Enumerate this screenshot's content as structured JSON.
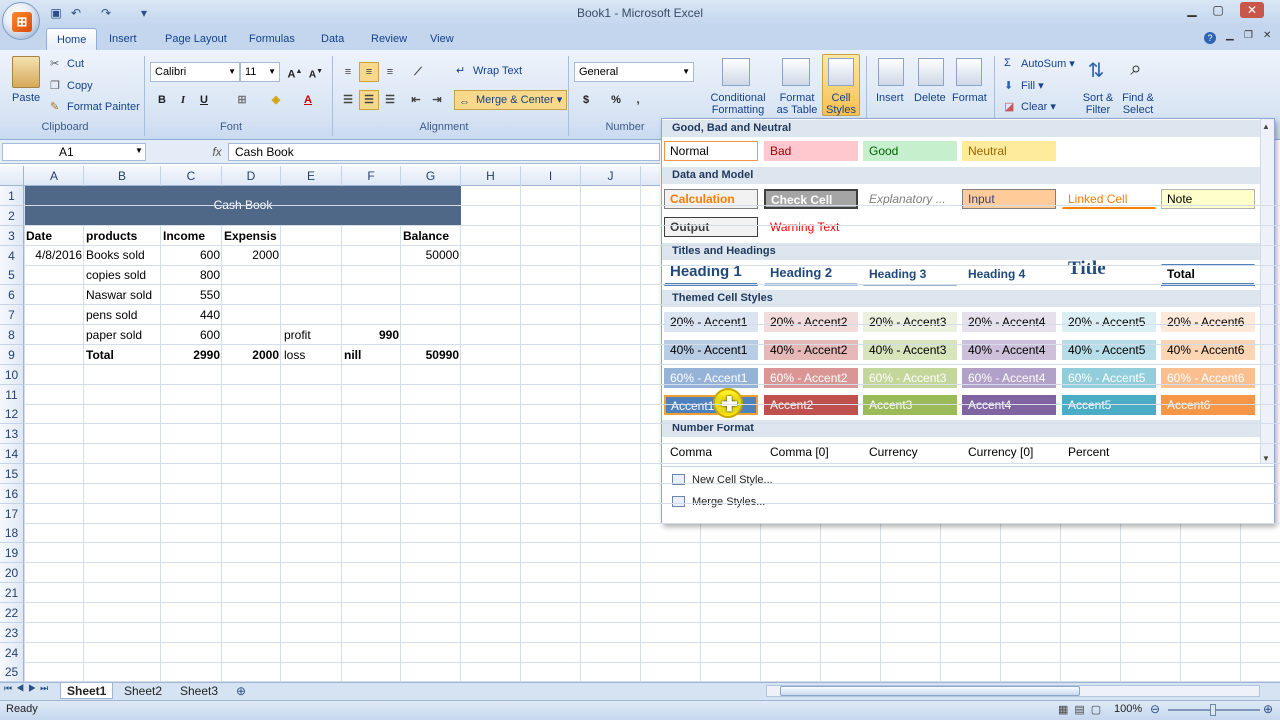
{
  "window": {
    "title": "Book1 - Microsoft Excel"
  },
  "tabs": [
    "Home",
    "Insert",
    "Page Layout",
    "Formulas",
    "Data",
    "Review",
    "View"
  ],
  "ribbon": {
    "clipboard": {
      "paste": "Paste",
      "cut": "Cut",
      "copy": "Copy",
      "format_painter": "Format Painter",
      "label": "Clipboard"
    },
    "font": {
      "name": "Calibri",
      "size": "11",
      "label": "Font",
      "bold": "B",
      "italic": "I",
      "underline": "U"
    },
    "alignment": {
      "wrap": "Wrap Text",
      "merge": "Merge & Center",
      "label": "Alignment"
    },
    "number": {
      "format": "General",
      "label": "Number",
      "currency": "$",
      "percent": "%",
      "comma": ","
    },
    "styles": {
      "conditional": "Conditional",
      "conditional2": "Formatting",
      "format_table": "Format",
      "format_table2": "as Table",
      "cell_styles": "Cell",
      "cell_styles2": "Styles"
    },
    "cells": {
      "insert": "Insert",
      "delete": "Delete",
      "format": "Format"
    },
    "editing": {
      "autosum": "AutoSum",
      "fill": "Fill",
      "clear": "Clear",
      "sort": "Sort &",
      "sort2": "Filter",
      "find": "Find &",
      "find2": "Select"
    }
  },
  "formula_bar": {
    "name_box": "A1",
    "fx": "fx",
    "value": "Cash Book"
  },
  "columns": [
    "A",
    "B",
    "C",
    "D",
    "E",
    "F",
    "G",
    "H",
    "I",
    "J"
  ],
  "rows": [
    "1",
    "2",
    "3",
    "4",
    "5",
    "6",
    "7",
    "8",
    "9",
    "10",
    "11",
    "12",
    "13",
    "14",
    "15",
    "16",
    "17",
    "18",
    "19",
    "20",
    "21",
    "22",
    "23",
    "24",
    "25"
  ],
  "sheet": {
    "merged_title": "Cash Book",
    "r3": {
      "a": "Date",
      "b": "products",
      "c": "Income",
      "d": "Expensis",
      "g": "Balance"
    },
    "r4": {
      "a": "4/8/2016",
      "b": "Books sold",
      "c": "600",
      "d": "2000",
      "g": "50000"
    },
    "r5": {
      "b": "copies sold",
      "c": "800"
    },
    "r6": {
      "b": "Naswar sold",
      "c": "550"
    },
    "r7": {
      "b": "pens sold",
      "c": "440"
    },
    "r8": {
      "b": "paper sold",
      "c": "600",
      "e": "profit",
      "f": "990"
    },
    "r9": {
      "b": "Total",
      "c": "2990",
      "d": "2000",
      "e": "loss",
      "f": "nill",
      "g": "50990"
    }
  },
  "gallery": {
    "sections": {
      "good_bad": "Good, Bad and Neutral",
      "data_model": "Data and Model",
      "titles": "Titles and Headings",
      "themed": "Themed Cell Styles",
      "number": "Number Format"
    },
    "good_bad": [
      "Normal",
      "Bad",
      "Good",
      "Neutral"
    ],
    "data_model_1": [
      "Calculation",
      "Check Cell",
      "Explanatory ...",
      "Input",
      "Linked Cell",
      "Note"
    ],
    "data_model_2": [
      "Output",
      "Warning Text"
    ],
    "titles": [
      "Heading 1",
      "Heading 2",
      "Heading 3",
      "Heading 4",
      "Title",
      "Total"
    ],
    "accent20": [
      "20% - Accent1",
      "20% - Accent2",
      "20% - Accent3",
      "20% - Accent4",
      "20% - Accent5",
      "20% - Accent6"
    ],
    "accent40": [
      "40% - Accent1",
      "40% - Accent2",
      "40% - Accent3",
      "40% - Accent4",
      "40% - Accent5",
      "40% - Accent6"
    ],
    "accent60": [
      "60% - Accent1",
      "60% - Accent2",
      "60% - Accent3",
      "60% - Accent4",
      "60% - Accent5",
      "60% - Accent6"
    ],
    "accent": [
      "Accent1",
      "Accent2",
      "Accent3",
      "Accent4",
      "Accent5",
      "Accent6"
    ],
    "number_fmt": [
      "Comma",
      "Comma [0]",
      "Currency",
      "Currency [0]",
      "Percent"
    ],
    "menu": [
      "New Cell Style...",
      "Merge Styles..."
    ]
  },
  "sheet_tabs": [
    "Sheet1",
    "Sheet2",
    "Sheet3"
  ],
  "status": {
    "ready": "Ready",
    "zoom": "100%"
  },
  "colors": {
    "accent1": "#4f81bd",
    "accent2": "#c0504d",
    "accent3": "#9bbb59",
    "accent4": "#8064a2",
    "accent5": "#4bacc6",
    "accent6": "#f79646"
  }
}
